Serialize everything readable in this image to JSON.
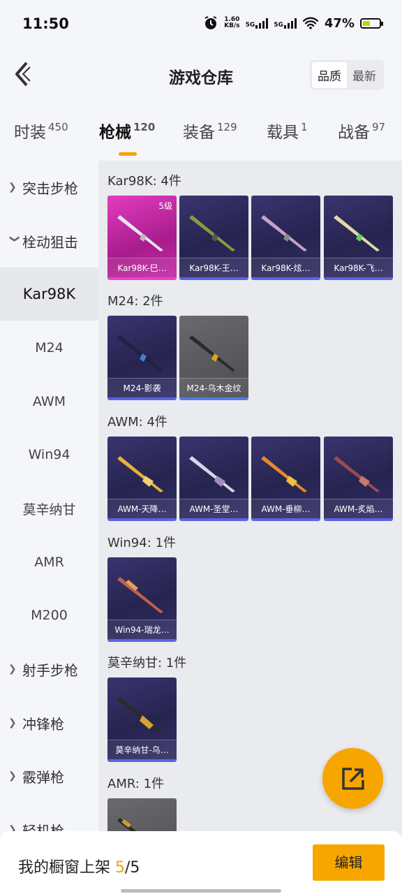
{
  "status": {
    "time": "11:50",
    "speed_value": "1.60",
    "speed_unit": "KB/s",
    "net1": "5G",
    "net2": "5G",
    "battery": "47%"
  },
  "header": {
    "title": "游戏仓库",
    "sort_quality": "品质",
    "sort_latest": "最新"
  },
  "tabs": [
    {
      "label": "时装",
      "count": "450"
    },
    {
      "label": "枪械",
      "count": "120"
    },
    {
      "label": "装备",
      "count": "129"
    },
    {
      "label": "载具",
      "count": "1"
    },
    {
      "label": "战备",
      "count": "97"
    }
  ],
  "sidebar": {
    "items": [
      {
        "label": "突击步枪"
      },
      {
        "label": "栓动狙击"
      },
      {
        "label": "Kar98K"
      },
      {
        "label": "M24"
      },
      {
        "label": "AWM"
      },
      {
        "label": "Win94"
      },
      {
        "label": "莫辛纳甘"
      },
      {
        "label": "AMR"
      },
      {
        "label": "M200"
      },
      {
        "label": "射手步枪"
      },
      {
        "label": "冲锋枪"
      },
      {
        "label": "霰弹枪"
      },
      {
        "label": "轻机枪"
      }
    ]
  },
  "sections": [
    {
      "title": "Kar98K: 4件",
      "cards": [
        {
          "label": "Kar98K-巳…",
          "level": "5级"
        },
        {
          "label": "Kar98K-王…"
        },
        {
          "label": "Kar98K-炫…"
        },
        {
          "label": "Kar98K-飞…"
        }
      ]
    },
    {
      "title": "M24: 2件",
      "cards": [
        {
          "label": "M24-影袭"
        },
        {
          "label": "M24-乌木金纹"
        }
      ]
    },
    {
      "title": "AWM: 4件",
      "cards": [
        {
          "label": "AWM-天降…"
        },
        {
          "label": "AWM-圣堂…"
        },
        {
          "label": "AWM-垂柳…"
        },
        {
          "label": "AWM-炙焰…"
        }
      ]
    },
    {
      "title": "Win94: 1件",
      "cards": [
        {
          "label": "Win94-瑞龙…"
        }
      ]
    },
    {
      "title": "莫辛纳甘: 1件",
      "cards": [
        {
          "label": "莫辛纳甘-乌…"
        }
      ]
    },
    {
      "title": "AMR: 1件"
    }
  ],
  "bottom": {
    "prefix": "我的橱窗上架",
    "count": "5",
    "slash_total": "/5",
    "edit": "编辑"
  },
  "icons": {
    "back": "back-arrow-icon",
    "fab": "share-export-icon"
  },
  "colors": {
    "accent": "#f7a600",
    "rare_purple": "#2f2b63",
    "legendary_pink": "#d62db3"
  }
}
